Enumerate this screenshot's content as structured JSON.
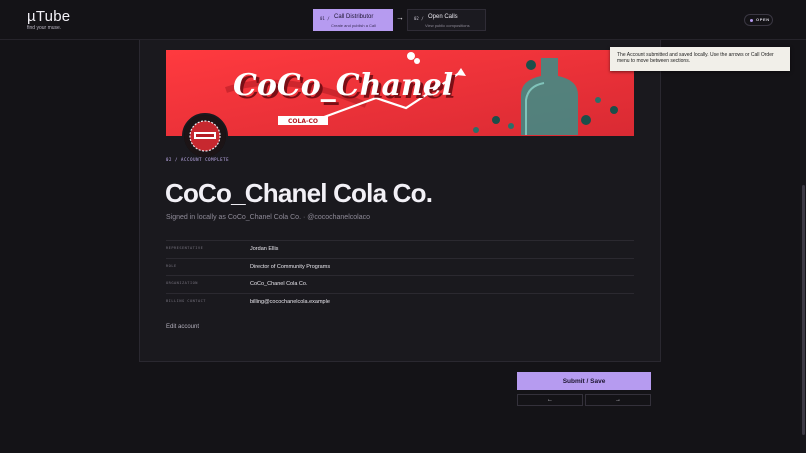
{
  "header": {
    "brand_name": "µTube",
    "brand_tagline": "find your muse.",
    "steps": [
      {
        "number": "01 /",
        "title": "Call Distributor",
        "subtitle": "Create and publish a Call"
      },
      {
        "number": "02 /",
        "title": "Open Calls",
        "subtitle": "View public compositions"
      }
    ],
    "status_badge": "OPEN"
  },
  "tooltip": {
    "text": "The Account submitted and saved locally. Use the arrows or Call Order menu to move between sections."
  },
  "account": {
    "banner_text": "CoCo_Chanel",
    "banner_subtext": "COLA-CO",
    "eyebrow": "02 / ACCOUNT COMPLETE",
    "name": "CoCo_Chanel Cola Co.",
    "subtitle": "Signed in locally as CoCo_Chanel Cola Co. · @cocochanelcolaco",
    "fields": [
      {
        "label": "REPRESENTATIVE",
        "value": "Jordan Ellis"
      },
      {
        "label": "ROLE",
        "value": "Director of Community Programs"
      },
      {
        "label": "ORGANIZATION",
        "value": "CoCo_Chanel Cola Co."
      },
      {
        "label": "BILLING CONTACT",
        "value": "billing@cocochanelcola.example"
      }
    ],
    "edit_link": "Edit account"
  },
  "actions": {
    "submit_label": "Submit / Save",
    "prev_label": "←",
    "next_label": "→"
  },
  "colors": {
    "accent": "#b69bf0",
    "background": "#141317",
    "card": "#1a191e",
    "banner_red": "#e8353b"
  },
  "icons": {
    "step_arrow": "arrow-right-icon",
    "prev": "arrow-left-icon",
    "next": "arrow-right-icon"
  }
}
